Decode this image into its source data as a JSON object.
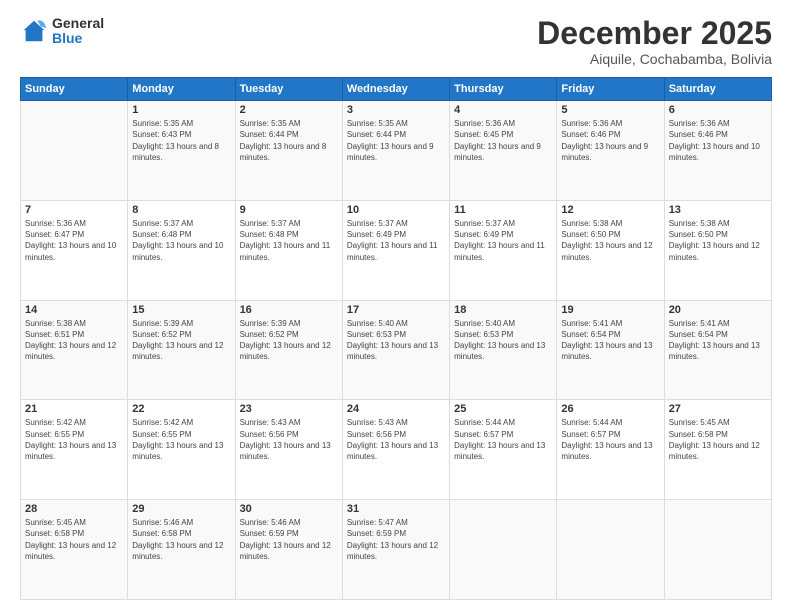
{
  "logo": {
    "general": "General",
    "blue": "Blue"
  },
  "header": {
    "month": "December 2025",
    "location": "Aiquile, Cochabamba, Bolivia"
  },
  "weekdays": [
    "Sunday",
    "Monday",
    "Tuesday",
    "Wednesday",
    "Thursday",
    "Friday",
    "Saturday"
  ],
  "weeks": [
    [
      {
        "day": "",
        "sunrise": "",
        "sunset": "",
        "daylight": ""
      },
      {
        "day": "1",
        "sunrise": "Sunrise: 5:35 AM",
        "sunset": "Sunset: 6:43 PM",
        "daylight": "Daylight: 13 hours and 8 minutes."
      },
      {
        "day": "2",
        "sunrise": "Sunrise: 5:35 AM",
        "sunset": "Sunset: 6:44 PM",
        "daylight": "Daylight: 13 hours and 8 minutes."
      },
      {
        "day": "3",
        "sunrise": "Sunrise: 5:35 AM",
        "sunset": "Sunset: 6:44 PM",
        "daylight": "Daylight: 13 hours and 9 minutes."
      },
      {
        "day": "4",
        "sunrise": "Sunrise: 5:36 AM",
        "sunset": "Sunset: 6:45 PM",
        "daylight": "Daylight: 13 hours and 9 minutes."
      },
      {
        "day": "5",
        "sunrise": "Sunrise: 5:36 AM",
        "sunset": "Sunset: 6:46 PM",
        "daylight": "Daylight: 13 hours and 9 minutes."
      },
      {
        "day": "6",
        "sunrise": "Sunrise: 5:36 AM",
        "sunset": "Sunset: 6:46 PM",
        "daylight": "Daylight: 13 hours and 10 minutes."
      }
    ],
    [
      {
        "day": "7",
        "sunrise": "Sunrise: 5:36 AM",
        "sunset": "Sunset: 6:47 PM",
        "daylight": "Daylight: 13 hours and 10 minutes."
      },
      {
        "day": "8",
        "sunrise": "Sunrise: 5:37 AM",
        "sunset": "Sunset: 6:48 PM",
        "daylight": "Daylight: 13 hours and 10 minutes."
      },
      {
        "day": "9",
        "sunrise": "Sunrise: 5:37 AM",
        "sunset": "Sunset: 6:48 PM",
        "daylight": "Daylight: 13 hours and 11 minutes."
      },
      {
        "day": "10",
        "sunrise": "Sunrise: 5:37 AM",
        "sunset": "Sunset: 6:49 PM",
        "daylight": "Daylight: 13 hours and 11 minutes."
      },
      {
        "day": "11",
        "sunrise": "Sunrise: 5:37 AM",
        "sunset": "Sunset: 6:49 PM",
        "daylight": "Daylight: 13 hours and 11 minutes."
      },
      {
        "day": "12",
        "sunrise": "Sunrise: 5:38 AM",
        "sunset": "Sunset: 6:50 PM",
        "daylight": "Daylight: 13 hours and 12 minutes."
      },
      {
        "day": "13",
        "sunrise": "Sunrise: 5:38 AM",
        "sunset": "Sunset: 6:50 PM",
        "daylight": "Daylight: 13 hours and 12 minutes."
      }
    ],
    [
      {
        "day": "14",
        "sunrise": "Sunrise: 5:38 AM",
        "sunset": "Sunset: 6:51 PM",
        "daylight": "Daylight: 13 hours and 12 minutes."
      },
      {
        "day": "15",
        "sunrise": "Sunrise: 5:39 AM",
        "sunset": "Sunset: 6:52 PM",
        "daylight": "Daylight: 13 hours and 12 minutes."
      },
      {
        "day": "16",
        "sunrise": "Sunrise: 5:39 AM",
        "sunset": "Sunset: 6:52 PM",
        "daylight": "Daylight: 13 hours and 12 minutes."
      },
      {
        "day": "17",
        "sunrise": "Sunrise: 5:40 AM",
        "sunset": "Sunset: 6:53 PM",
        "daylight": "Daylight: 13 hours and 13 minutes."
      },
      {
        "day": "18",
        "sunrise": "Sunrise: 5:40 AM",
        "sunset": "Sunset: 6:53 PM",
        "daylight": "Daylight: 13 hours and 13 minutes."
      },
      {
        "day": "19",
        "sunrise": "Sunrise: 5:41 AM",
        "sunset": "Sunset: 6:54 PM",
        "daylight": "Daylight: 13 hours and 13 minutes."
      },
      {
        "day": "20",
        "sunrise": "Sunrise: 5:41 AM",
        "sunset": "Sunset: 6:54 PM",
        "daylight": "Daylight: 13 hours and 13 minutes."
      }
    ],
    [
      {
        "day": "21",
        "sunrise": "Sunrise: 5:42 AM",
        "sunset": "Sunset: 6:55 PM",
        "daylight": "Daylight: 13 hours and 13 minutes."
      },
      {
        "day": "22",
        "sunrise": "Sunrise: 5:42 AM",
        "sunset": "Sunset: 6:55 PM",
        "daylight": "Daylight: 13 hours and 13 minutes."
      },
      {
        "day": "23",
        "sunrise": "Sunrise: 5:43 AM",
        "sunset": "Sunset: 6:56 PM",
        "daylight": "Daylight: 13 hours and 13 minutes."
      },
      {
        "day": "24",
        "sunrise": "Sunrise: 5:43 AM",
        "sunset": "Sunset: 6:56 PM",
        "daylight": "Daylight: 13 hours and 13 minutes."
      },
      {
        "day": "25",
        "sunrise": "Sunrise: 5:44 AM",
        "sunset": "Sunset: 6:57 PM",
        "daylight": "Daylight: 13 hours and 13 minutes."
      },
      {
        "day": "26",
        "sunrise": "Sunrise: 5:44 AM",
        "sunset": "Sunset: 6:57 PM",
        "daylight": "Daylight: 13 hours and 13 minutes."
      },
      {
        "day": "27",
        "sunrise": "Sunrise: 5:45 AM",
        "sunset": "Sunset: 6:58 PM",
        "daylight": "Daylight: 13 hours and 12 minutes."
      }
    ],
    [
      {
        "day": "28",
        "sunrise": "Sunrise: 5:45 AM",
        "sunset": "Sunset: 6:58 PM",
        "daylight": "Daylight: 13 hours and 12 minutes."
      },
      {
        "day": "29",
        "sunrise": "Sunrise: 5:46 AM",
        "sunset": "Sunset: 6:58 PM",
        "daylight": "Daylight: 13 hours and 12 minutes."
      },
      {
        "day": "30",
        "sunrise": "Sunrise: 5:46 AM",
        "sunset": "Sunset: 6:59 PM",
        "daylight": "Daylight: 13 hours and 12 minutes."
      },
      {
        "day": "31",
        "sunrise": "Sunrise: 5:47 AM",
        "sunset": "Sunset: 6:59 PM",
        "daylight": "Daylight: 13 hours and 12 minutes."
      },
      {
        "day": "",
        "sunrise": "",
        "sunset": "",
        "daylight": ""
      },
      {
        "day": "",
        "sunrise": "",
        "sunset": "",
        "daylight": ""
      },
      {
        "day": "",
        "sunrise": "",
        "sunset": "",
        "daylight": ""
      }
    ]
  ]
}
